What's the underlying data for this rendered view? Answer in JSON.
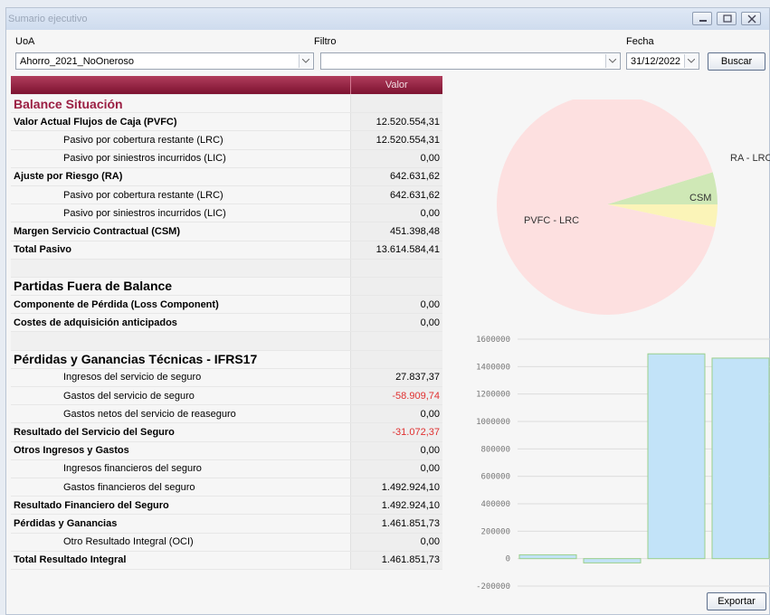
{
  "window": {
    "title": "Sumario ejecutivo"
  },
  "filters": {
    "uoa_label": "UoA",
    "uoa_value": "Ahorro_2021_NoOneroso",
    "filtro_label": "Filtro",
    "filtro_value": "",
    "fecha_label": "Fecha",
    "fecha_value": "31/12/2022",
    "buscar_label": "Buscar"
  },
  "table": {
    "value_header": "Valor",
    "rows": [
      {
        "type": "sec1",
        "label": "Balance Situación",
        "value": ""
      },
      {
        "type": "bold",
        "label": "Valor Actual Flujos de Caja (PVFC)",
        "value": "12.520.554,31"
      },
      {
        "type": "sub",
        "label": "Pasivo por cobertura restante (LRC)",
        "value": "12.520.554,31"
      },
      {
        "type": "sub",
        "label": "Pasivo por siniestros incurridos (LIC)",
        "value": "0,00"
      },
      {
        "type": "bold",
        "label": "Ajuste por Riesgo (RA)",
        "value": "642.631,62"
      },
      {
        "type": "sub",
        "label": "Pasivo por cobertura restante (LRC)",
        "value": "642.631,62"
      },
      {
        "type": "sub",
        "label": "Pasivo por siniestros incurridos (LIC)",
        "value": "0,00"
      },
      {
        "type": "bold",
        "label": "Margen Servicio Contractual (CSM)",
        "value": "451.398,48"
      },
      {
        "type": "bold",
        "label": "Total Pasivo",
        "value": "13.614.584,41"
      },
      {
        "type": "empty",
        "label": "",
        "value": ""
      },
      {
        "type": "sec",
        "label": "Partidas Fuera de Balance",
        "value": ""
      },
      {
        "type": "bold",
        "label": "Componente de Pérdida (Loss Component)",
        "value": "0,00"
      },
      {
        "type": "bold",
        "label": "Costes de adquisición anticipados",
        "value": "0,00"
      },
      {
        "type": "empty",
        "label": "",
        "value": ""
      },
      {
        "type": "sec",
        "label": "Pérdidas y Ganancias Técnicas - IFRS17",
        "value": ""
      },
      {
        "type": "sub",
        "label": "Ingresos del servicio de seguro",
        "value": "27.837,37"
      },
      {
        "type": "sub",
        "label": "Gastos del servicio de seguro",
        "value": "-58.909,74",
        "neg": true
      },
      {
        "type": "sub",
        "label": "Gastos netos del servicio de reaseguro",
        "value": "0,00"
      },
      {
        "type": "bold",
        "label": "Resultado del Servicio del Seguro",
        "value": "-31.072,37",
        "neg": true
      },
      {
        "type": "bold",
        "label": "Otros Ingresos y Gastos",
        "value": "0,00"
      },
      {
        "type": "sub",
        "label": "Ingresos financieros del seguro",
        "value": "0,00"
      },
      {
        "type": "sub",
        "label": "Gastos financieros del seguro",
        "value": "1.492.924,10"
      },
      {
        "type": "bold",
        "label": "Resultado Financiero del Seguro",
        "value": "1.492.924,10"
      },
      {
        "type": "bold",
        "label": "Pérdidas y Ganancias",
        "value": "1.461.851,73"
      },
      {
        "type": "sub",
        "label": "Otro Resultado Integral (OCI)",
        "value": "0,00"
      },
      {
        "type": "bold",
        "label": "Total Resultado Integral",
        "value": "1.461.851,73"
      }
    ]
  },
  "charts": {
    "pie": {
      "slices": [
        {
          "label": "PVFC - LRC",
          "value": 12520554.31,
          "color": "#fde0e0"
        },
        {
          "label": "RA - LRC",
          "value": 642631.62,
          "color": "#cfe8b6"
        },
        {
          "label": "CSM",
          "value": 451398.48,
          "color": "#fbf4b8"
        }
      ]
    },
    "bar": {
      "ticks": [
        "1600000",
        "1400000",
        "1200000",
        "1000000",
        "800000",
        "600000",
        "400000",
        "200000",
        "0",
        "-200000"
      ],
      "values": [
        27837.37,
        -31072.37,
        1492924.1,
        1461851.73
      ],
      "ymin": -200000,
      "ymax": 1600000
    }
  },
  "export_label": "Exportar",
  "colors": {
    "header": "#8a1a3a",
    "section": "#9b1f43",
    "negative": "#e03030",
    "bar_fill": "#c2e3f8",
    "bar_stroke": "#9bd08c"
  }
}
